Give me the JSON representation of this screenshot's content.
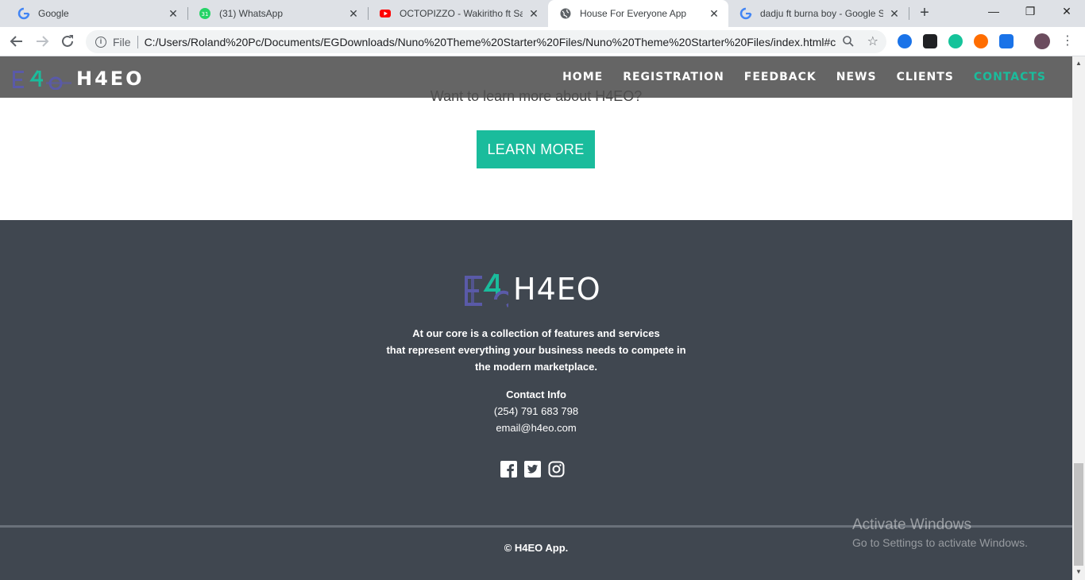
{
  "browser": {
    "tabs": [
      {
        "title": "Google",
        "favicon": "google-icon"
      },
      {
        "title": "(31) WhatsApp",
        "favicon": "whatsapp-icon",
        "badge": "31"
      },
      {
        "title": "OCTOPIZZO - Wakiritho ft Sailo",
        "favicon": "youtube-icon"
      },
      {
        "title": "House For Everyone App",
        "favicon": "globe-icon",
        "active": true
      },
      {
        "title": "dadju ft burna boy - Google Se",
        "favicon": "google-icon"
      }
    ],
    "address_scheme": "File",
    "address_url": "C:/Users/Roland%20Pc/Documents/EGDownloads/Nuno%20Theme%20Starter%20Files/Nuno%20Theme%20Starter%20Files/index.html#cl..."
  },
  "site": {
    "brand": "H4EO",
    "nav": [
      "HOME",
      "REGISTRATION",
      "FEEDBACK",
      "NEWS",
      "CLIENTS",
      "CONTACTS"
    ],
    "active_nav": "CONTACTS",
    "learn_question": "Want to learn more about H4EO?",
    "learn_button": "LEARN MORE",
    "accent_color": "#1abc9c",
    "footer": {
      "brand": "H4EO",
      "desc_lines": [
        "At our core is a collection of features and services",
        "that represent everything your business needs to compete in",
        "the modern marketplace."
      ],
      "contact_heading": "Contact Info",
      "phone": "(254) 791 683 798",
      "email": "email@h4eo.com",
      "social": [
        "facebook-icon",
        "twitter-icon",
        "instagram-icon"
      ],
      "copyright": "© H4EO App.",
      "bg_color": "#404750"
    }
  },
  "os": {
    "watermark_title": "Activate Windows",
    "watermark_sub": "Go to Settings to activate Windows."
  }
}
